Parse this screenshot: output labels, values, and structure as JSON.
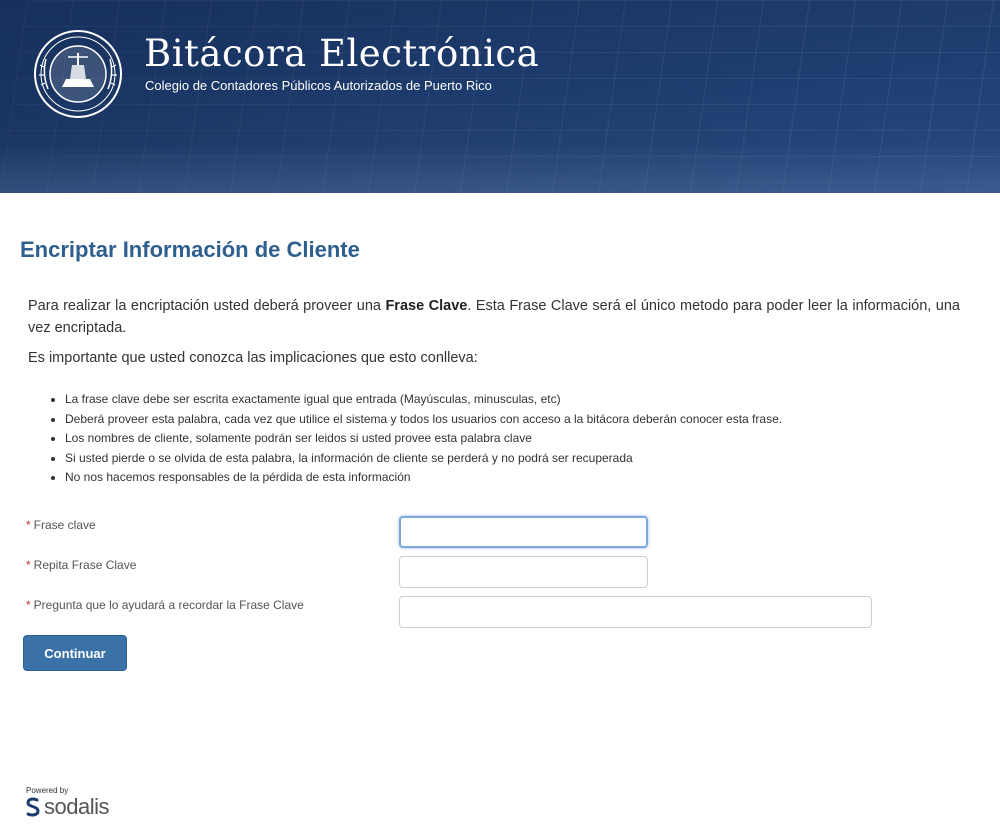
{
  "header": {
    "title": "Bitácora Electrónica",
    "subtitle": "Colegio de Contadores Públicos Autorizados de Puerto Rico",
    "logo_icon": "seal-icon"
  },
  "main": {
    "page_title": "Encriptar Información de Cliente",
    "intro_before": "Para realizar la encriptación usted deberá proveer una ",
    "intro_bold": "Frase Clave",
    "intro_after": ". Esta Frase Clave será el único metodo para poder leer la información, una vez encriptada.",
    "implications_heading": "Es importante que usted conozca las implicaciones que esto conlleva:",
    "bullets": [
      "La frase clave debe ser escrita exactamente igual que entrada (Mayúsculas, minusculas, etc)",
      "Deberá proveer esta palabra, cada vez que utilice el sistema y todos los usuarios con acceso a la bitácora deberán conocer esta frase.",
      "Los nombres de cliente, solamente podrán ser leidos si usted provee esta palabra clave",
      "Si usted pierde o se olvida de esta palabra, la información de cliente se perderá y no podrá ser recuperada",
      "No nos hacemos responsables de la pérdida de esta información"
    ]
  },
  "form": {
    "required_marker": "*",
    "fields": [
      {
        "label": "Frase clave",
        "value": ""
      },
      {
        "label": "Repita Frase Clave",
        "value": ""
      },
      {
        "label": "Pregunta que lo ayudará a recordar la Frase Clave",
        "value": ""
      }
    ],
    "submit_label": "Continuar"
  },
  "footer": {
    "powered_by": "Powered by",
    "brand": "sodalis",
    "brand_icon": "sodalis-logo-icon"
  },
  "colors": {
    "banner": "#1f4175",
    "title": "#2e5f8e",
    "button": "#3a72a8",
    "required": "#c0392b"
  }
}
